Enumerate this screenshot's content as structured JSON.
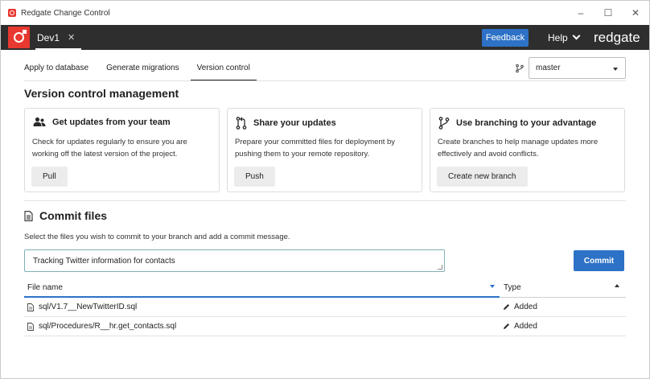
{
  "window": {
    "title": "Redgate Change Control",
    "minimize_glyph": "–",
    "maximize_glyph": "☐",
    "close_glyph": "✕"
  },
  "header": {
    "database_tab": "Dev1",
    "tab_close_glyph": "✕",
    "feedback_label": "Feedback",
    "help_label": "Help",
    "brand": "redgate"
  },
  "nav": {
    "tabs": [
      {
        "label": "Apply to database",
        "active": false
      },
      {
        "label": "Generate migrations",
        "active": false
      },
      {
        "label": "Version control",
        "active": true
      }
    ]
  },
  "branch": {
    "selected": "master"
  },
  "page": {
    "title": "Version control management"
  },
  "cards": [
    {
      "icon": "team-icon",
      "title": "Get updates from your team",
      "description": "Check for updates regularly to ensure you are working off the latest version of the project.",
      "button": "Pull"
    },
    {
      "icon": "pull-request-icon",
      "title": "Share your updates",
      "description": "Prepare your committed files for deployment by pushing them to your remote repository.",
      "button": "Push"
    },
    {
      "icon": "branch-icon",
      "title": "Use branching to your advantage",
      "description": "Create branches to help manage updates more effectively and avoid conflicts.",
      "button": "Create new branch"
    }
  ],
  "commit": {
    "title": "Commit files",
    "description": "Select the files you wish to commit to your branch and add a commit message.",
    "message": "Tracking Twitter information for contacts",
    "button": "Commit"
  },
  "table": {
    "columns": {
      "file": "File name",
      "type": "Type"
    },
    "rows": [
      {
        "file": "sql/V1.7__NewTwitterID.sql",
        "type": "Added"
      },
      {
        "file": "sql/Procedures/R__hr.get_contacts.sql",
        "type": "Added"
      }
    ]
  },
  "colors": {
    "brand_red": "#e8382f",
    "header_dark": "#2e2e2e",
    "accent_blue": "#2d72c7"
  }
}
